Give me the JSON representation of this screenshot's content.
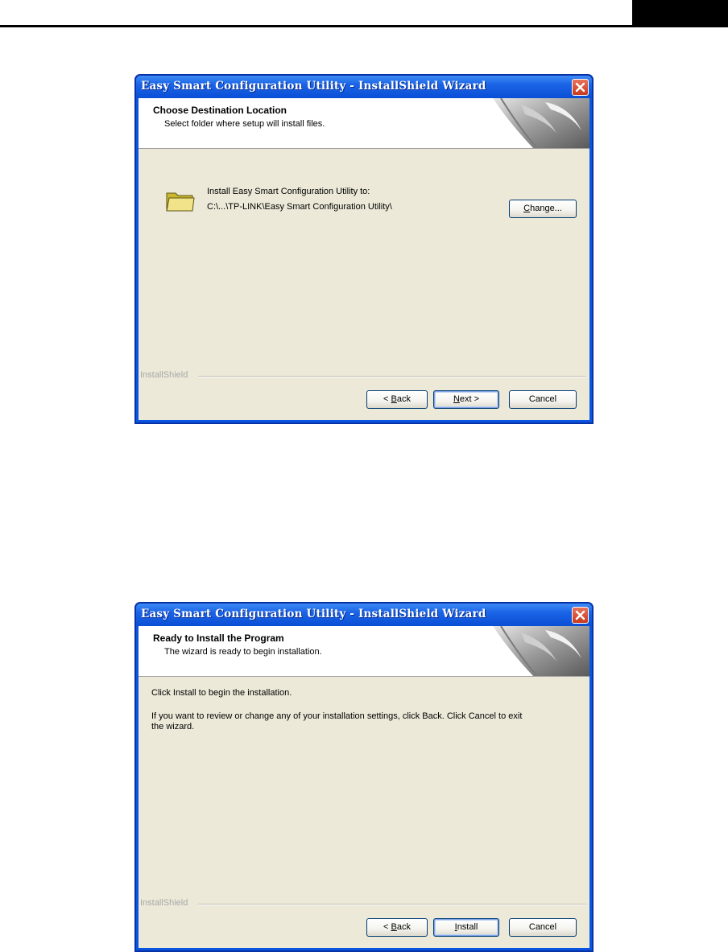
{
  "dialog1": {
    "title": "Easy Smart Configuration Utility - InstallShield Wizard",
    "heading": "Choose Destination Location",
    "subheading": "Select folder where setup will install files.",
    "install_label": "Install Easy Smart Configuration Utility to:",
    "install_path": "C:\\...\\TP-LINK\\Easy Smart Configuration Utility\\",
    "change_button": {
      "mnemonic": "C",
      "rest": "hange..."
    },
    "brand": "InstallShield",
    "back_button": {
      "prefix": "< ",
      "mnemonic": "B",
      "rest": "ack"
    },
    "next_button": {
      "mnemonic": "N",
      "rest": "ext >"
    },
    "cancel_label": "Cancel"
  },
  "dialog2": {
    "title": "Easy Smart Configuration Utility - InstallShield Wizard",
    "heading": "Ready to Install the Program",
    "subheading": "The wizard is ready to begin installation.",
    "line1": "Click Install to begin the installation.",
    "line2": "If you want to review or change any of your installation settings, click Back. Click Cancel to exit",
    "line3": "the wizard.",
    "brand": "InstallShield",
    "back_button": {
      "prefix": "< ",
      "mnemonic": "B",
      "rest": "ack"
    },
    "install_button": {
      "mnemonic": "I",
      "rest": "nstall"
    },
    "cancel_label": "Cancel"
  },
  "icons": [
    "close-icon",
    "folder-icon",
    "installshield-graphic"
  ]
}
